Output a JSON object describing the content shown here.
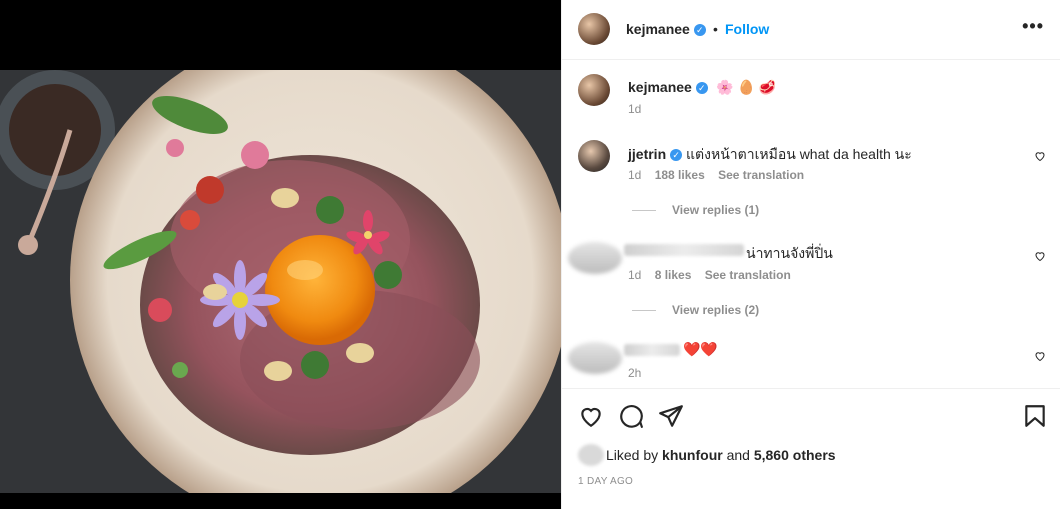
{
  "post": {
    "username": "kejmanee",
    "follow_label": "Follow",
    "more_label": "•••",
    "caption_emojis": "🌸 🥚 🥩",
    "caption_time": "1d"
  },
  "comments": [
    {
      "username": "jjetrin",
      "text": "แต่งหน้าตาเหมือน what da health นะ",
      "time": "1d",
      "likes": "188 likes",
      "translate": "See translation",
      "replies": "View replies (1)"
    },
    {
      "text": "น่าทานจังพี่ปิ่น",
      "time": "1d",
      "likes": "8 likes",
      "translate": "See translation",
      "replies": "View replies (2)"
    },
    {
      "text": "❤️❤️",
      "time": "2h"
    }
  ],
  "footer": {
    "liked_by_prefix": "Liked by",
    "liked_by_user": "khunfour",
    "and_label": "and",
    "others": "5,860 others",
    "date": "1 DAY AGO"
  },
  "icons": {
    "heart": "heart-icon",
    "comment": "comment-icon",
    "share": "share-icon",
    "save": "bookmark-icon",
    "verified": "verified-badge-icon"
  },
  "colors": {
    "accent": "#0095f6",
    "verified": "#3897f0",
    "meta": "#8e8e8e"
  }
}
